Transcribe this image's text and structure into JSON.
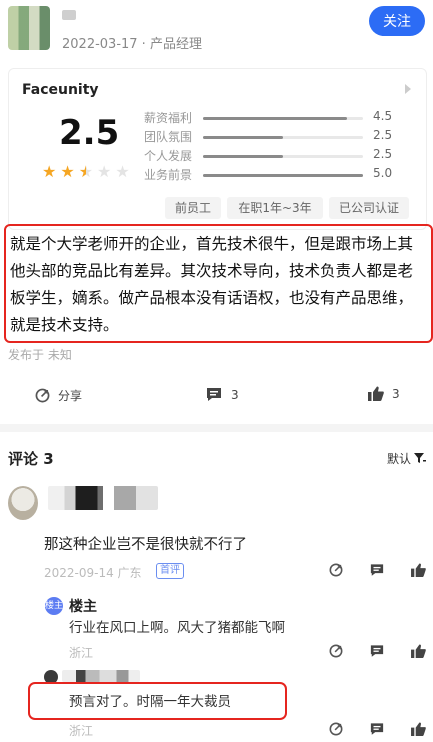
{
  "header": {
    "meta": "2022-03-17 · 产品经理",
    "follow_label": "关注"
  },
  "card": {
    "company": "Faceunity",
    "score": "2.5",
    "stars": 2.5,
    "ratings": [
      {
        "label": "薪资福利",
        "value": "4.5",
        "fraction": 0.9
      },
      {
        "label": "团队氛围",
        "value": "2.5",
        "fraction": 0.5
      },
      {
        "label": "个人发展",
        "value": "2.5",
        "fraction": 0.5
      },
      {
        "label": "业务前景",
        "value": "5.0",
        "fraction": 1.0
      }
    ],
    "tags": [
      "前员工",
      "在职1年~3年",
      "已公司认证"
    ]
  },
  "review": {
    "text": "就是个大学老师开的企业，首先技术很牛，但是跟市场上其他头部的竞品比有差异。其次技术导向，技术负责人都是老板学生，嫡系。做产品根本没有话语权，也没有产品思维，就是技术支持。",
    "published": "发布于 未知"
  },
  "actions": {
    "share_label": "分享",
    "comment_count": "3",
    "like_count": "3"
  },
  "comments_section": {
    "title": "评论 3",
    "sort_label": "默认"
  },
  "comments": [
    {
      "text": "那这种企业岂不是很快就不行了",
      "date": "2022-09-14 广东",
      "badge": "首评"
    }
  ],
  "reply": {
    "host_icon": "楼主",
    "host_name": "楼主",
    "text": "行业在风口上啊。风大了猪都能飞啊",
    "location": "浙江"
  },
  "comment2": {
    "text": "预言对了。时隔一年大裁员",
    "location": "浙江"
  },
  "colors": {
    "accent": "#2c6cf5",
    "star": "#f5a623",
    "highlight_border": "#e5251f"
  }
}
